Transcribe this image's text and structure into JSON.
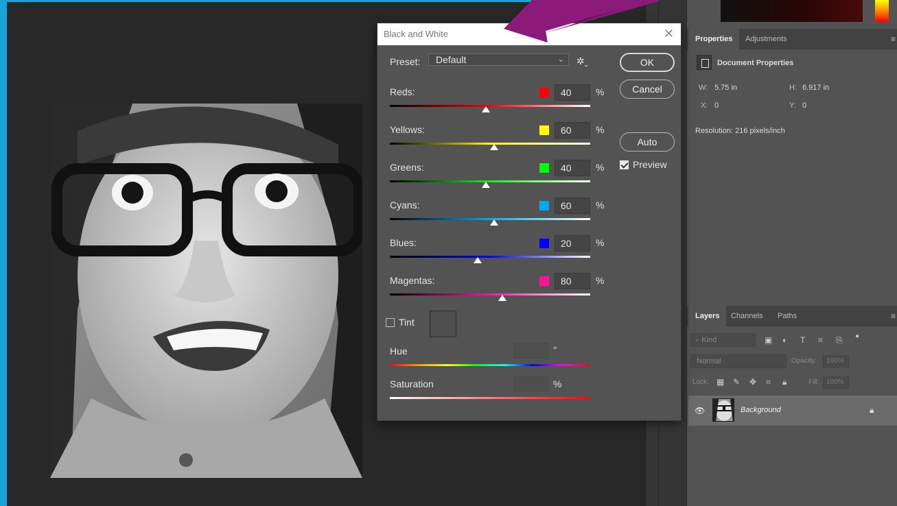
{
  "dialog": {
    "title": "Black and White",
    "preset_label": "Preset:",
    "preset_value": "Default",
    "ok_label": "OK",
    "cancel_label": "Cancel",
    "auto_label": "Auto",
    "preview_label": "Preview",
    "preview_checked": true,
    "tint_label": "Tint",
    "tint_checked": false,
    "hue_label": "Hue",
    "hue_unit": "°",
    "saturation_label": "Saturation",
    "saturation_unit": "%",
    "channels": [
      {
        "label": "Reds:",
        "value": "40",
        "unit": "%",
        "color": "#ff0000",
        "slider": 0.48
      },
      {
        "label": "Yellows:",
        "value": "60",
        "unit": "%",
        "color": "#ffff00",
        "slider": 0.52
      },
      {
        "label": "Greens:",
        "value": "40",
        "unit": "%",
        "color": "#00ff00",
        "slider": 0.48
      },
      {
        "label": "Cyans:",
        "value": "60",
        "unit": "%",
        "color": "#00aaee",
        "slider": 0.52
      },
      {
        "label": "Blues:",
        "value": "20",
        "unit": "%",
        "color": "#0000ff",
        "slider": 0.44
      },
      {
        "label": "Magentas:",
        "value": "80",
        "unit": "%",
        "color": "#ff1493",
        "slider": 0.56
      }
    ]
  },
  "properties_panel": {
    "tabs": [
      "Properties",
      "Adjustments"
    ],
    "active_tab": "Properties",
    "section_title": "Document Properties",
    "w_label": "W:",
    "w_value": "5.75 in",
    "h_label": "H:",
    "h_value": "6.917 in",
    "x_label": "X:",
    "x_value": "0",
    "y_label": "Y:",
    "y_value": "0",
    "resolution": "Resolution: 216 pixels/inch"
  },
  "layers_panel": {
    "tabs": [
      "Layers",
      "Channels",
      "Paths"
    ],
    "active_tab": "Layers",
    "kind_placeholder": "Kind",
    "blend_mode": "Normal",
    "opacity_label": "Opacity:",
    "opacity_value": "100%",
    "lock_label": "Lock:",
    "fill_label": "Fill:",
    "fill_value": "100%",
    "layer_name": "Background"
  },
  "colors": {
    "canvas_bg": "#282828",
    "panel_bg": "#535353",
    "frame_accent": "#1aa3d8",
    "arrow": "#8b1a7a"
  }
}
